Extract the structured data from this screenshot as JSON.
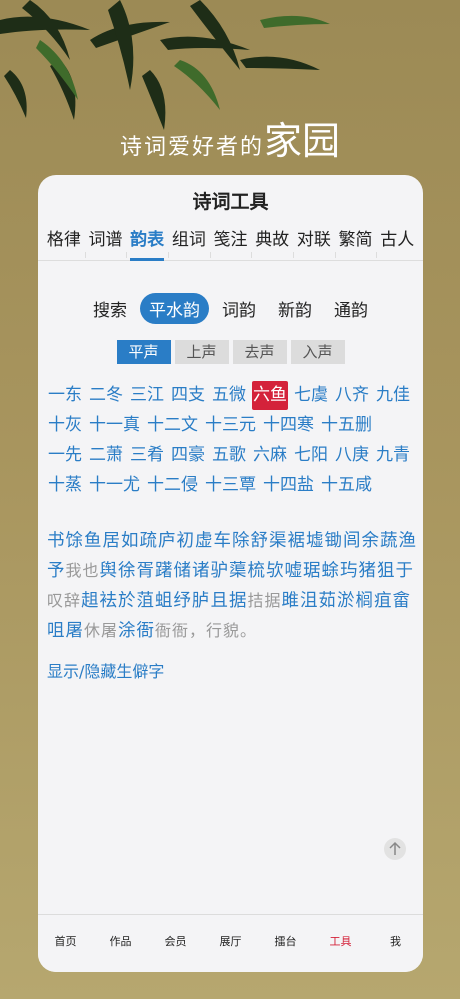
{
  "header": {
    "slogan_small": "诗词爱好者的",
    "slogan_large": "家园"
  },
  "card": {
    "title": "诗词工具"
  },
  "tabs": [
    "格律",
    "词谱",
    "韵表",
    "组词",
    "笺注",
    "典故",
    "对联",
    "繁简",
    "古人"
  ],
  "active_tab": "韵表",
  "subtabs": [
    "搜索",
    "平水韵",
    "词韵",
    "新韵",
    "通韵"
  ],
  "active_subtab": "平水韵",
  "tones": [
    "平声",
    "上声",
    "去声",
    "入声"
  ],
  "active_tone": "平声",
  "rhymes": [
    "一东",
    "二冬",
    "三江",
    "四支",
    "五微",
    "六鱼",
    "七虞",
    "八齐",
    "九佳",
    "十灰",
    "十一真",
    "十二文",
    "十三元",
    "十四寒",
    "十五删",
    "一先",
    "二萧",
    "三肴",
    "四豪",
    "五歌",
    "六麻",
    "七阳",
    "八庚",
    "九青",
    "十蒸",
    "十一尤",
    "十二侵",
    "十三覃",
    "十四盐",
    "十五咸"
  ],
  "active_rhyme": "六鱼",
  "char_segments": [
    {
      "t": "书馀鱼居如疏庐初虚车除舒渠裾墟锄闾余蔬渔予",
      "k": "c"
    },
    {
      "t": "我也",
      "k": "r"
    },
    {
      "t": "舆徐胥躇储诸驴蕖梳欤嘘琚蜍玙猪狙于",
      "k": "c"
    },
    {
      "t": "叹辞",
      "k": "r"
    },
    {
      "t": "趄袪於菹蛆纾胪且据",
      "k": "c"
    },
    {
      "t": "拮据",
      "k": "r"
    },
    {
      "t": "雎沮茹淤榈疽畲咀屠",
      "k": "c"
    },
    {
      "t": "休屠",
      "k": "r"
    },
    {
      "t": "涂衙",
      "k": "c"
    },
    {
      "t": "衙衙，行貌。",
      "k": "r"
    }
  ],
  "toggle_label": "显示/隐藏生僻字",
  "bottom_nav": [
    "首页",
    "作品",
    "会员",
    "展厅",
    "擂台",
    "工具",
    "我"
  ],
  "active_nav": "工具",
  "colors": {
    "accent": "#2a7dc6",
    "highlight": "#d4223a",
    "background": "#a8955e"
  },
  "icons": {
    "scroll_top": "arrow-up-icon",
    "decoration": "bamboo-leaves"
  }
}
